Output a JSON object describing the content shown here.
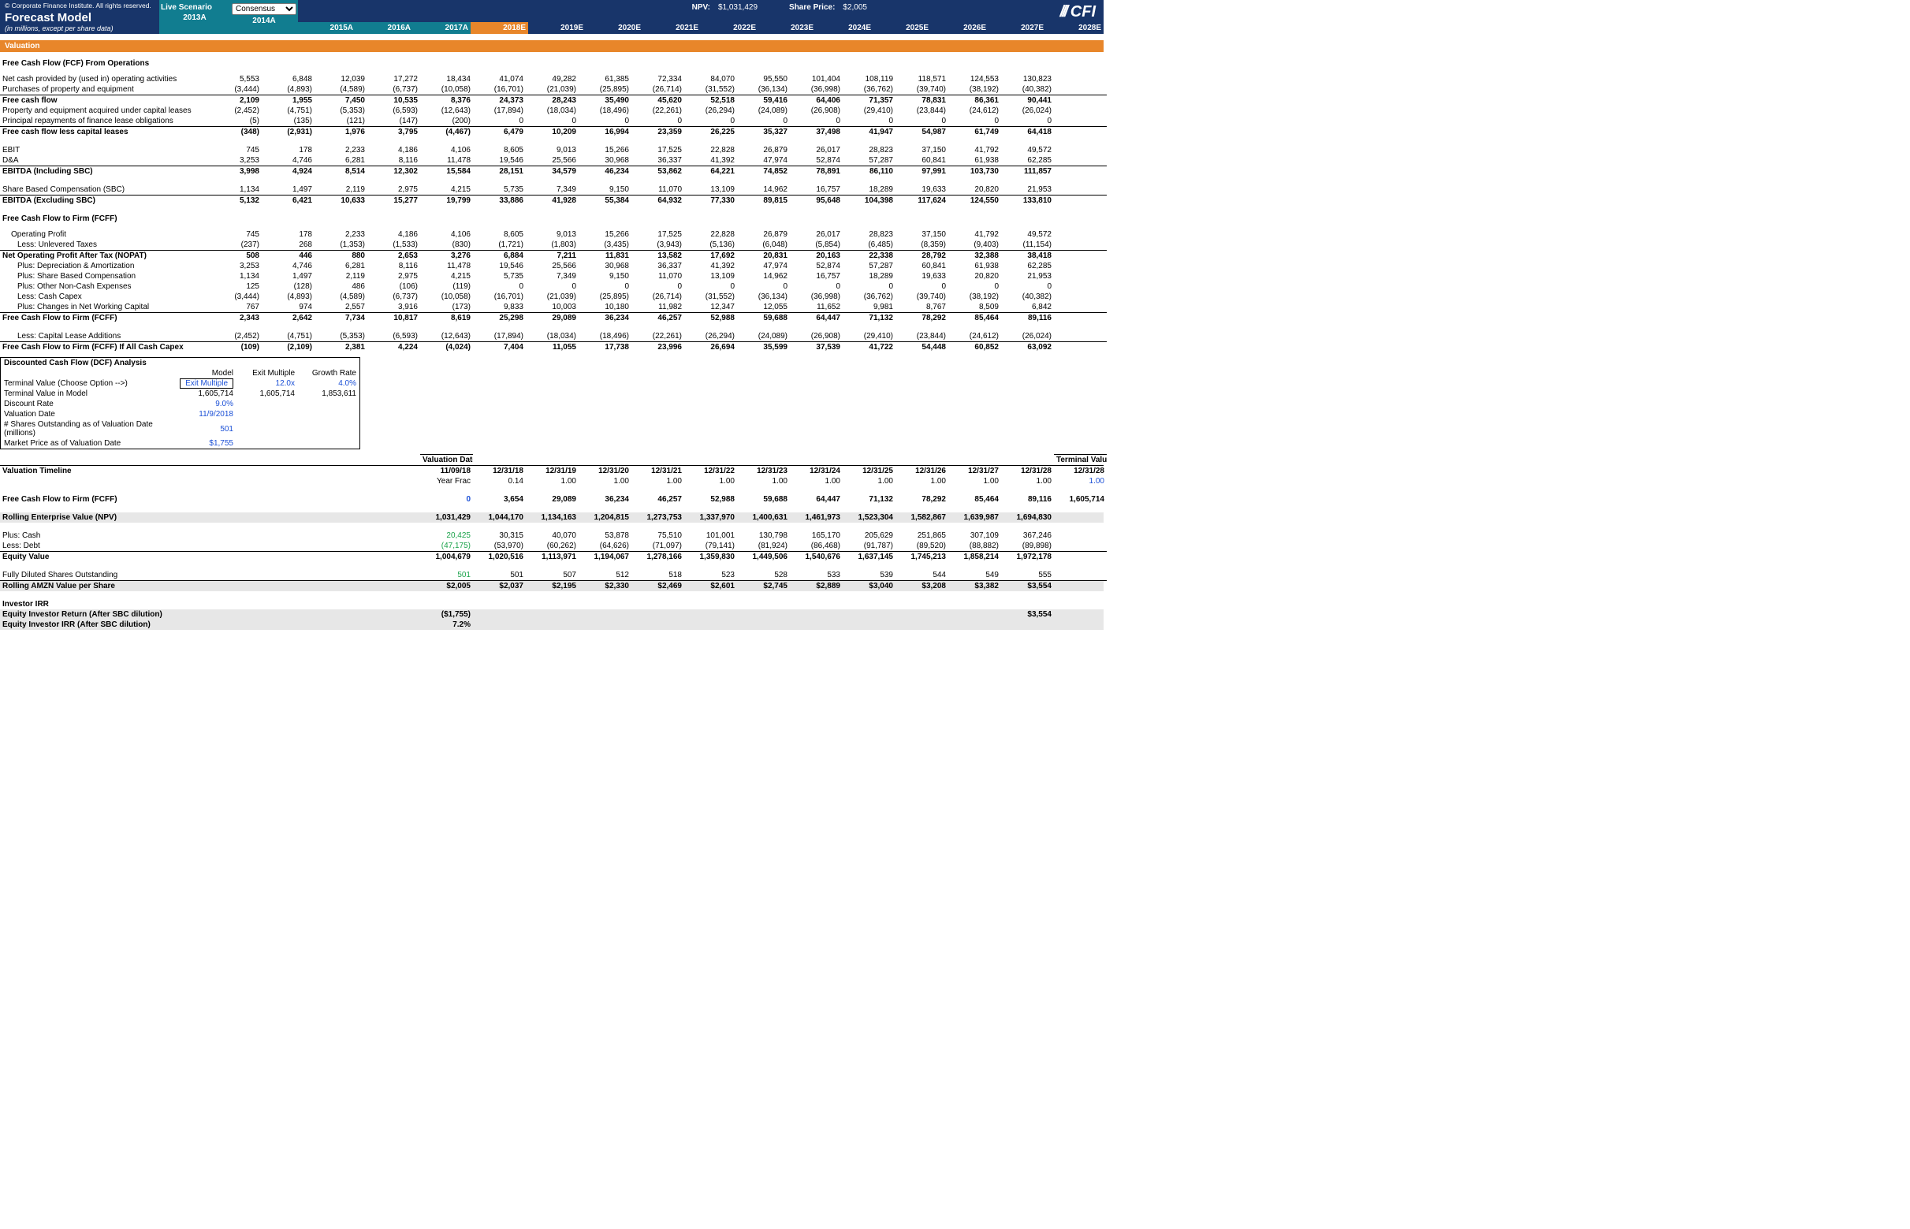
{
  "copyright": "© Corporate Finance Institute. All rights reserved.",
  "title": "Forecast Model",
  "subtitle": "(in millions, except per share data)",
  "live_scenario": "Live Scenario",
  "scenario_select": "Consensus",
  "years": [
    "2013A",
    "2014A",
    "2015A",
    "2016A",
    "2017A",
    "2018E",
    "2019E",
    "2020E",
    "2021E",
    "2022E",
    "2023E",
    "2024E",
    "2025E",
    "2026E",
    "2027E",
    "2028E"
  ],
  "summary": {
    "npv_label": "NPV:",
    "npv": "$1,031,429",
    "sp_label": "Share Price:",
    "sp": "$2,005"
  },
  "logo": "CFI",
  "valuation_header": "Valuation",
  "dcf": {
    "header_cols": [
      "Model",
      "Exit Multiple",
      "Growth Rate"
    ],
    "rows": [
      {
        "label": "Terminal Value (Choose Option -->)",
        "c": [
          "Exit Multiple",
          "12.0x",
          "4.0%"
        ],
        "blue": true,
        "boxed": true
      },
      {
        "label": "Terminal Value in Model",
        "c": [
          "1,605,714",
          "1,605,714",
          "1,853,611"
        ]
      },
      {
        "label": "Discount Rate",
        "c": [
          "9.0%",
          "",
          ""
        ],
        "blue": true
      },
      {
        "label": "Valuation Date",
        "c": [
          "11/9/2018",
          "",
          ""
        ],
        "blue": true
      },
      {
        "label": "# Shares Outstanding as of Valuation Date (millions)",
        "c": [
          "501",
          "",
          ""
        ],
        "blue": true
      },
      {
        "label": "Market Price as of Valuation Date",
        "c": [
          "$1,755",
          "",
          ""
        ],
        "blue": true
      }
    ],
    "title": "Discounted Cash Flow (DCF) Analysis"
  },
  "rows": {
    "fcfo_head": "Free Cash Flow (FCF) From Operations",
    "ncp": {
      "label": "Net cash provided by (used in) operating activities",
      "v": [
        "5,553",
        "6,848",
        "12,039",
        "17,272",
        "18,434",
        "41,074",
        "49,282",
        "61,385",
        "72,334",
        "84,070",
        "95,550",
        "101,404",
        "108,119",
        "118,571",
        "124,553",
        "130,823"
      ]
    },
    "ppe": {
      "label": "Purchases of property and equipment",
      "v": [
        "(3,444)",
        "(4,893)",
        "(4,589)",
        "(6,737)",
        "(10,058)",
        "(16,701)",
        "(21,039)",
        "(25,895)",
        "(26,714)",
        "(31,552)",
        "(36,134)",
        "(36,998)",
        "(36,762)",
        "(39,740)",
        "(38,192)",
        "(40,382)"
      ]
    },
    "fcf": {
      "label": "Free cash flow",
      "v": [
        "2,109",
        "1,955",
        "7,450",
        "10,535",
        "8,376",
        "24,373",
        "28,243",
        "35,490",
        "45,620",
        "52,518",
        "59,416",
        "64,406",
        "71,357",
        "78,831",
        "86,361",
        "90,441"
      ]
    },
    "pel": {
      "label": "Property and equipment acquired under capital leases",
      "v": [
        "(2,452)",
        "(4,751)",
        "(5,353)",
        "(6,593)",
        "(12,643)",
        "(17,894)",
        "(18,034)",
        "(18,496)",
        "(22,261)",
        "(26,294)",
        "(24,089)",
        "(26,908)",
        "(29,410)",
        "(23,844)",
        "(24,612)",
        "(26,024)"
      ]
    },
    "prf": {
      "label": "Principal repayments of finance lease obligations",
      "v": [
        "(5)",
        "(135)",
        "(121)",
        "(147)",
        "(200)",
        "0",
        "0",
        "0",
        "0",
        "0",
        "0",
        "0",
        "0",
        "0",
        "0",
        "0"
      ]
    },
    "fcflc": {
      "label": "Free cash flow less capital leases",
      "v": [
        "(348)",
        "(2,931)",
        "1,976",
        "3,795",
        "(4,467)",
        "6,479",
        "10,209",
        "16,994",
        "23,359",
        "26,225",
        "35,327",
        "37,498",
        "41,947",
        "54,987",
        "61,749",
        "64,418"
      ]
    },
    "ebit": {
      "label": "EBIT",
      "v": [
        "745",
        "178",
        "2,233",
        "4,186",
        "4,106",
        "8,605",
        "9,013",
        "15,266",
        "17,525",
        "22,828",
        "26,879",
        "26,017",
        "28,823",
        "37,150",
        "41,792",
        "49,572"
      ]
    },
    "da": {
      "label": "D&A",
      "v": [
        "3,253",
        "4,746",
        "6,281",
        "8,116",
        "11,478",
        "19,546",
        "25,566",
        "30,968",
        "36,337",
        "41,392",
        "47,974",
        "52,874",
        "57,287",
        "60,841",
        "61,938",
        "62,285"
      ]
    },
    "ebitda_inc": {
      "label": "EBITDA (Including SBC)",
      "v": [
        "3,998",
        "4,924",
        "8,514",
        "12,302",
        "15,584",
        "28,151",
        "34,579",
        "46,234",
        "53,862",
        "64,221",
        "74,852",
        "78,891",
        "86,110",
        "97,991",
        "103,730",
        "111,857"
      ]
    },
    "sbc": {
      "label": "Share Based Compensation (SBC)",
      "v": [
        "1,134",
        "1,497",
        "2,119",
        "2,975",
        "4,215",
        "5,735",
        "7,349",
        "9,150",
        "11,070",
        "13,109",
        "14,962",
        "16,757",
        "18,289",
        "19,633",
        "20,820",
        "21,953"
      ]
    },
    "ebitda_exc": {
      "label": "EBITDA (Excluding SBC)",
      "v": [
        "5,132",
        "6,421",
        "10,633",
        "15,277",
        "19,799",
        "33,886",
        "41,928",
        "55,384",
        "64,932",
        "77,330",
        "89,815",
        "95,648",
        "104,398",
        "117,624",
        "124,550",
        "133,810"
      ]
    },
    "fcff_head": "Free Cash Flow to Firm (FCFF)",
    "op": {
      "label": "Operating Profit",
      "v": [
        "745",
        "178",
        "2,233",
        "4,186",
        "4,106",
        "8,605",
        "9,013",
        "15,266",
        "17,525",
        "22,828",
        "26,879",
        "26,017",
        "28,823",
        "37,150",
        "41,792",
        "49,572"
      ]
    },
    "ulx": {
      "label": "Less: Unlevered Taxes",
      "v": [
        "(237)",
        "268",
        "(1,353)",
        "(1,533)",
        "(830)",
        "(1,721)",
        "(1,803)",
        "(3,435)",
        "(3,943)",
        "(5,136)",
        "(6,048)",
        "(5,854)",
        "(6,485)",
        "(8,359)",
        "(9,403)",
        "(11,154)"
      ]
    },
    "nopat": {
      "label": "Net Operating Profit After Tax (NOPAT)",
      "v": [
        "508",
        "446",
        "880",
        "2,653",
        "3,276",
        "6,884",
        "7,211",
        "11,831",
        "13,582",
        "17,692",
        "20,831",
        "20,163",
        "22,338",
        "28,792",
        "32,388",
        "38,418"
      ]
    },
    "pda": {
      "label": "Plus: Depreciation & Amortization",
      "v": [
        "3,253",
        "4,746",
        "6,281",
        "8,116",
        "11,478",
        "19,546",
        "25,566",
        "30,968",
        "36,337",
        "41,392",
        "47,974",
        "52,874",
        "57,287",
        "60,841",
        "61,938",
        "62,285"
      ]
    },
    "psbc": {
      "label": "Plus: Share Based Compensation",
      "v": [
        "1,134",
        "1,497",
        "2,119",
        "2,975",
        "4,215",
        "5,735",
        "7,349",
        "9,150",
        "11,070",
        "13,109",
        "14,962",
        "16,757",
        "18,289",
        "19,633",
        "20,820",
        "21,953"
      ]
    },
    "pnc": {
      "label": "Plus: Other Non-Cash Expenses",
      "v": [
        "125",
        "(128)",
        "486",
        "(106)",
        "(119)",
        "0",
        "0",
        "0",
        "0",
        "0",
        "0",
        "0",
        "0",
        "0",
        "0",
        "0"
      ]
    },
    "lcc": {
      "label": "Less: Cash Capex",
      "v": [
        "(3,444)",
        "(4,893)",
        "(4,589)",
        "(6,737)",
        "(10,058)",
        "(16,701)",
        "(21,039)",
        "(25,895)",
        "(26,714)",
        "(31,552)",
        "(36,134)",
        "(36,998)",
        "(36,762)",
        "(39,740)",
        "(38,192)",
        "(40,382)"
      ]
    },
    "nwc": {
      "label": "Plus: Changes in Net Working Capital",
      "v": [
        "767",
        "974",
        "2,557",
        "3,916",
        "(173)",
        "9,833",
        "10,003",
        "10,180",
        "11,982",
        "12,347",
        "12,055",
        "11,652",
        "9,981",
        "8,767",
        "8,509",
        "6,842"
      ]
    },
    "fcff": {
      "label": "Free Cash Flow to Firm (FCFF)",
      "v": [
        "2,343",
        "2,642",
        "7,734",
        "10,817",
        "8,619",
        "25,298",
        "29,089",
        "36,234",
        "46,257",
        "52,988",
        "59,688",
        "64,447",
        "71,132",
        "78,292",
        "85,464",
        "89,116"
      ]
    },
    "lcla": {
      "label": "Less: Capital Lease Additions",
      "v": [
        "(2,452)",
        "(4,751)",
        "(5,353)",
        "(6,593)",
        "(12,643)",
        "(17,894)",
        "(18,034)",
        "(18,496)",
        "(22,261)",
        "(26,294)",
        "(24,089)",
        "(26,908)",
        "(29,410)",
        "(23,844)",
        "(24,612)",
        "(26,024)"
      ]
    },
    "fcff_all": {
      "label": "Free Cash Flow to Firm (FCFF) If All Cash Capex",
      "v": [
        "(109)",
        "(2,109)",
        "2,381",
        "4,224",
        "(4,024)",
        "7,404",
        "11,055",
        "17,738",
        "23,996",
        "26,694",
        "35,599",
        "37,539",
        "41,722",
        "54,448",
        "60,852",
        "63,092"
      ]
    }
  },
  "timeline": {
    "val_date_hdr": "Valuation Date",
    "tv_hdr": "Terminal Value",
    "title": "Valuation Timeline",
    "dates": [
      "11/09/18",
      "12/31/18",
      "12/31/19",
      "12/31/20",
      "12/31/21",
      "12/31/22",
      "12/31/23",
      "12/31/24",
      "12/31/25",
      "12/31/26",
      "12/31/27",
      "12/31/28",
      "12/31/28"
    ],
    "yf_label": "Year Frac",
    "yf": [
      "",
      "0.14",
      "1.00",
      "1.00",
      "1.00",
      "1.00",
      "1.00",
      "1.00",
      "1.00",
      "1.00",
      "1.00",
      "1.00",
      "1.00"
    ],
    "fcff_row": {
      "label": "Free Cash Flow to Firm (FCFF)",
      "v": [
        "0",
        "3,654",
        "29,089",
        "36,234",
        "46,257",
        "52,988",
        "59,688",
        "64,447",
        "71,132",
        "78,292",
        "85,464",
        "89,116",
        "1,605,714"
      ]
    },
    "ev": {
      "label": "Rolling Enterprise Value (NPV)",
      "v": [
        "1,031,429",
        "1,044,170",
        "1,134,163",
        "1,204,815",
        "1,273,753",
        "1,337,970",
        "1,400,631",
        "1,461,973",
        "1,523,304",
        "1,582,867",
        "1,639,987",
        "1,694,830",
        ""
      ]
    },
    "cash": {
      "label": "Plus: Cash",
      "v": [
        "20,425",
        "30,315",
        "40,070",
        "53,878",
        "75,510",
        "101,001",
        "130,798",
        "165,170",
        "205,629",
        "251,865",
        "307,109",
        "367,246",
        ""
      ]
    },
    "debt": {
      "label": "Less: Debt",
      "v": [
        "(47,175)",
        "(53,970)",
        "(60,262)",
        "(64,626)",
        "(71,097)",
        "(79,141)",
        "(81,924)",
        "(86,468)",
        "(91,787)",
        "(89,520)",
        "(88,882)",
        "(89,898)",
        ""
      ]
    },
    "eq": {
      "label": "Equity Value",
      "v": [
        "1,004,679",
        "1,020,516",
        "1,113,971",
        "1,194,067",
        "1,278,166",
        "1,359,830",
        "1,449,506",
        "1,540,676",
        "1,637,145",
        "1,745,213",
        "1,858,214",
        "1,972,178",
        ""
      ]
    },
    "fdso": {
      "label": "Fully Diluted Shares Outstanding",
      "v": [
        "501",
        "501",
        "507",
        "512",
        "518",
        "523",
        "528",
        "533",
        "539",
        "544",
        "549",
        "555",
        ""
      ]
    },
    "vps": {
      "label": "Rolling AMZN Value per Share",
      "v": [
        "$2,005",
        "$2,037",
        "$2,195",
        "$2,330",
        "$2,469",
        "$2,601",
        "$2,745",
        "$2,889",
        "$3,040",
        "$3,208",
        "$3,382",
        "$3,554",
        ""
      ]
    }
  },
  "irr": {
    "title": "Investor IRR",
    "r1": {
      "label": "Equity Investor Return (After SBC dilution)",
      "a": "($1,755)",
      "b": "$3,554"
    },
    "r2": {
      "label": "Equity Investor IRR (After SBC dilution)",
      "a": "7.2%"
    }
  }
}
